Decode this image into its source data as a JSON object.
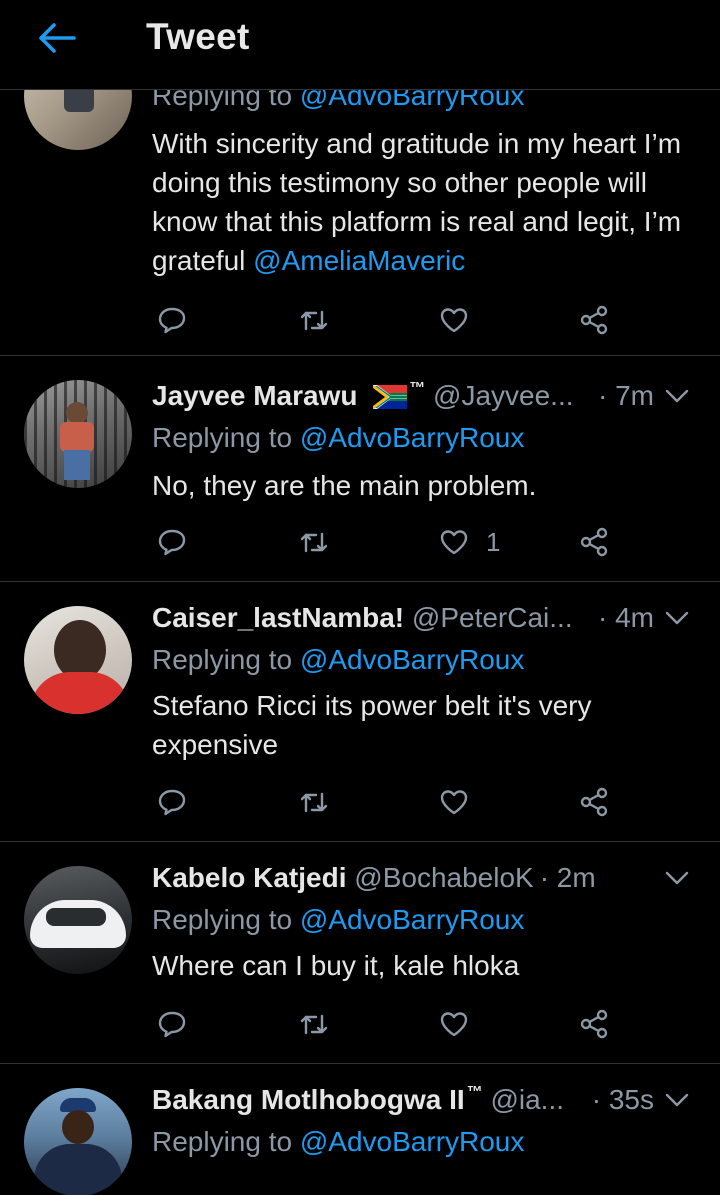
{
  "header": {
    "title": "Tweet"
  },
  "tweets": [
    {
      "replying_prefix": "Replying to ",
      "replying_to": "@AdvoBarryRoux",
      "text_main": "With sincerity and gratitude in my heart I’m doing this testimony so other people will know that this platform is real and legit, I’m grateful ",
      "text_mention": "@AmeliaMaveric",
      "likes": ""
    },
    {
      "name": "Jayvee Marawu",
      "name_suffix": "™",
      "handle": "@Jayvee...",
      "time": "· 7m",
      "replying_prefix": "Replying to ",
      "replying_to": "@AdvoBarryRoux",
      "text": "No, they are the main problem.",
      "likes": "1"
    },
    {
      "name": "Caiser_lastNamba!",
      "handle": "@PeterCai...",
      "time": "· 4m",
      "replying_prefix": "Replying to ",
      "replying_to": "@AdvoBarryRoux",
      "text": "Stefano Ricci its power belt it's very expensive",
      "likes": ""
    },
    {
      "name": "Kabelo Katjedi",
      "handle": "@BochabeloK",
      "time": "· 2m",
      "replying_prefix": "Replying to ",
      "replying_to": "@AdvoBarryRoux",
      "text": "Where can I buy it, kale hloka",
      "likes": ""
    },
    {
      "name": "Bakang Motlhobogwa II",
      "name_suffix": "™",
      "handle": "@ia...",
      "time": "· 35s",
      "replying_prefix": "Replying to ",
      "replying_to": "@AdvoBarryRoux"
    }
  ],
  "colors": {
    "accent": "#1d9bf0",
    "muted": "#8b98a5",
    "divider": "#2f3336",
    "background": "#000000"
  },
  "icons": [
    "back-arrow-icon",
    "reply-icon",
    "retweet-icon",
    "like-icon",
    "share-icon",
    "chevron-down-icon",
    "south-africa-flag-icon"
  ]
}
